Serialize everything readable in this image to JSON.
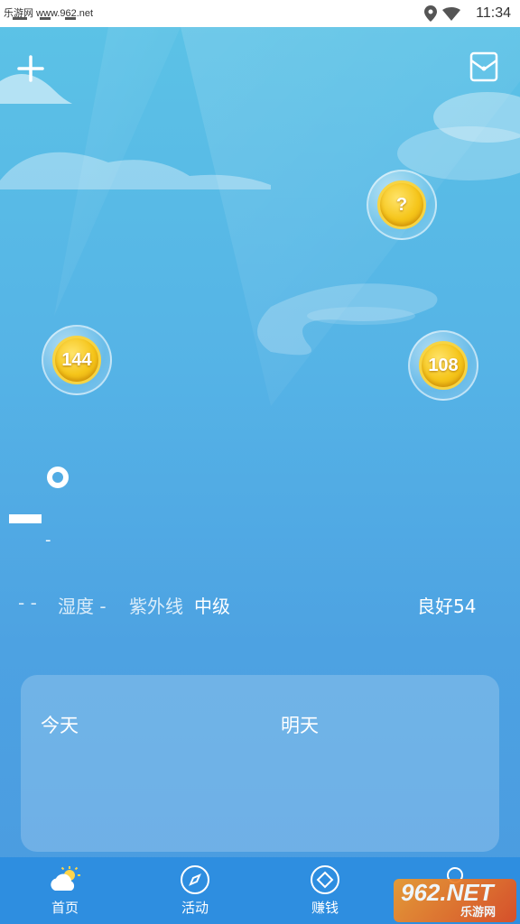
{
  "status_bar": {
    "watermark_text": "乐游网 www.962.net",
    "time": "11:34",
    "icons": [
      "location-icon",
      "wifi-icon"
    ]
  },
  "top_bar": {
    "add_icon": "plus-icon",
    "mail_icon": "envelope-icon"
  },
  "bubbles": [
    {
      "label": "?"
    },
    {
      "label": "144"
    },
    {
      "label": "108"
    }
  ],
  "current": {
    "temp_unit_symbol": "degree-symbol",
    "sub_dash": "-"
  },
  "info_row": {
    "wind": "- -",
    "humidity": "湿度 -",
    "uv_label": "紫外线",
    "uv_value": "中级",
    "aqi": "良好54"
  },
  "forecast": {
    "today": "今天",
    "tomorrow": "明天"
  },
  "tabs": [
    {
      "label": "首页",
      "icon": "weather-sun-cloud-icon"
    },
    {
      "label": "活动",
      "icon": "compass-icon"
    },
    {
      "label": "赚钱",
      "icon": "diamond-icon"
    },
    {
      "label": "",
      "icon": "profile-icon"
    }
  ],
  "watermark": {
    "logo_text": "962.NET",
    "logo_sub": "乐游网"
  },
  "colors": {
    "sky_top": "#5cc3e6",
    "sky_bottom": "#4a9be0",
    "tab_bar": "#2e8ee0",
    "coin": "#f5c51a"
  }
}
